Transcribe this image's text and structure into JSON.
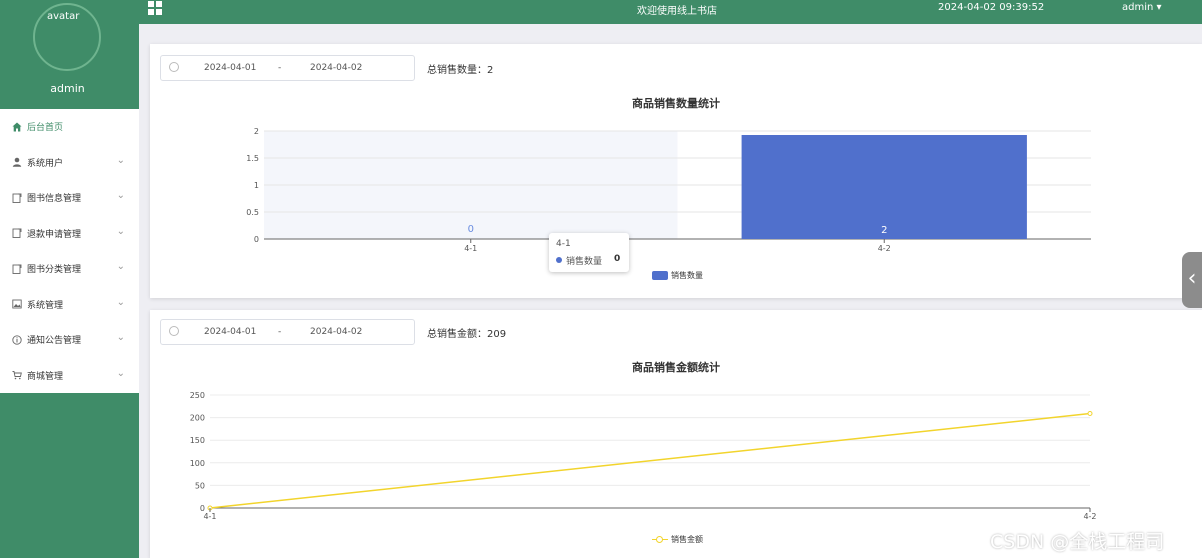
{
  "sidebar": {
    "avatar_alt": "avatar",
    "username": "admin",
    "menu": [
      {
        "label": "后台首页",
        "icon": "home-icon",
        "has_submenu": false,
        "active": true
      },
      {
        "label": "系统用户",
        "icon": "user-icon",
        "has_submenu": true
      },
      {
        "label": "图书信息管理",
        "icon": "document-icon",
        "has_submenu": true
      },
      {
        "label": "退款申请管理",
        "icon": "document-icon",
        "has_submenu": true
      },
      {
        "label": "图书分类管理",
        "icon": "document-icon",
        "has_submenu": true
      },
      {
        "label": "系统管理",
        "icon": "picture-icon",
        "has_submenu": true
      },
      {
        "label": "通知公告管理",
        "icon": "info-icon",
        "has_submenu": true
      },
      {
        "label": "商城管理",
        "icon": "cart-icon",
        "has_submenu": true
      }
    ]
  },
  "topbar": {
    "welcome": "欢迎使用线上书店",
    "datetime": "2024-04-02 09:39:52",
    "user": "admin"
  },
  "quantity_panel": {
    "start_date": "2024-04-01",
    "separator": "-",
    "end_date": "2024-04-02",
    "summary_label": "总销售数量：",
    "summary_value": "2",
    "tooltip": {
      "title": "4-1",
      "series": "销售数量",
      "value": "0"
    }
  },
  "amount_panel": {
    "start_date": "2024-04-01",
    "separator": "-",
    "end_date": "2024-04-02",
    "summary_label": "总销售金额：",
    "summary_value": "209"
  },
  "watermark": "CSDN @全栈工程司",
  "colors": {
    "primary": "#3f8c68",
    "bar": "#5070cc",
    "line": "#f2d42c"
  },
  "chart_data": [
    {
      "type": "bar",
      "title": "商品销售数量统计",
      "categories": [
        "4-1",
        "4-2"
      ],
      "series": [
        {
          "name": "销售数量",
          "values": [
            0,
            2
          ]
        }
      ],
      "data_labels": [
        "0",
        "2"
      ],
      "ylim": [
        0,
        2
      ],
      "yticks": [
        "0",
        "0.5",
        "1",
        "1.5",
        "2"
      ],
      "grid": true,
      "legend": "bottom-center"
    },
    {
      "type": "line",
      "title": "商品销售金额统计",
      "categories": [
        "4-1",
        "4-2"
      ],
      "series": [
        {
          "name": "销售金额",
          "values": [
            0,
            209
          ]
        }
      ],
      "ylim": [
        0,
        250
      ],
      "yticks": [
        "0",
        "50",
        "100",
        "150",
        "200",
        "250"
      ],
      "grid": true,
      "legend": "bottom-center"
    }
  ]
}
